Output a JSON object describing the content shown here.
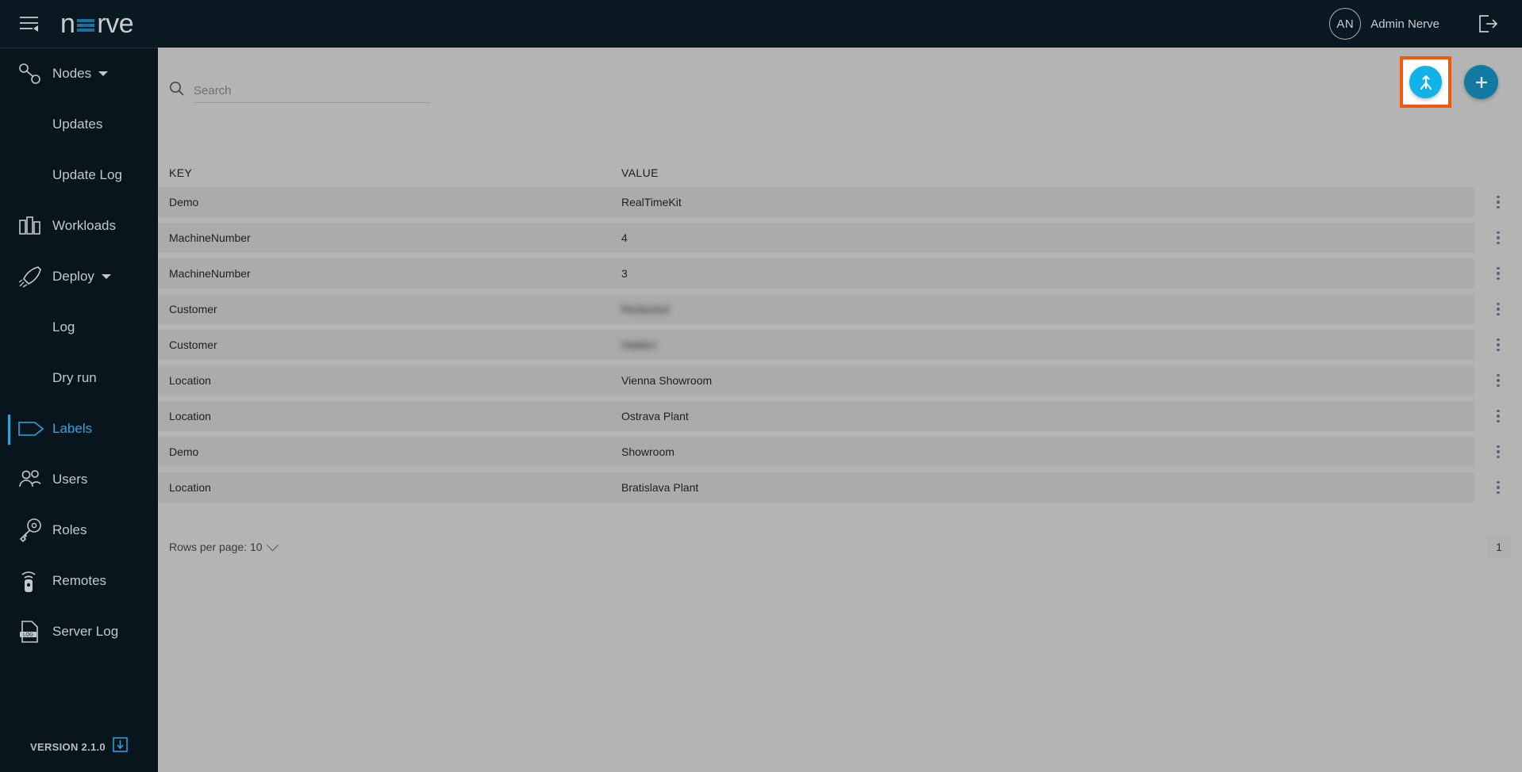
{
  "app": {
    "brand_prefix": "n",
    "brand_suffix": "rve",
    "menu_icon": "menu-collapse-icon"
  },
  "topbar": {
    "user_initials": "AN",
    "user_name": "Admin Nerve",
    "logout_icon": "logout-icon"
  },
  "sidebar": {
    "items": [
      {
        "label": "Nodes",
        "icon": "nodes-icon",
        "type": "group",
        "expanded": true,
        "active": false
      },
      {
        "label": "Updates",
        "icon": "",
        "type": "sub",
        "active": false
      },
      {
        "label": "Update Log",
        "icon": "",
        "type": "sub",
        "active": false
      },
      {
        "label": "Workloads",
        "icon": "workloads-icon",
        "type": "item",
        "active": false
      },
      {
        "label": "Deploy",
        "icon": "deploy-icon",
        "type": "group",
        "expanded": true,
        "active": false
      },
      {
        "label": "Log",
        "icon": "",
        "type": "sub",
        "active": false
      },
      {
        "label": "Dry run",
        "icon": "",
        "type": "sub",
        "active": false
      },
      {
        "label": "Labels",
        "icon": "label-tag-icon",
        "type": "item",
        "active": true
      },
      {
        "label": "Users",
        "icon": "users-icon",
        "type": "item",
        "active": false
      },
      {
        "label": "Roles",
        "icon": "roles-key-icon",
        "type": "item",
        "active": false
      },
      {
        "label": "Remotes",
        "icon": "remote-icon",
        "type": "item",
        "active": false
      },
      {
        "label": "Server Log",
        "icon": "server-log-icon",
        "type": "item",
        "active": false
      }
    ],
    "version_label": "VERSION 2.1.0",
    "version_icon": "download-icon"
  },
  "main": {
    "search": {
      "placeholder": "Search",
      "value": "",
      "icon": "search-icon"
    },
    "actions": [
      {
        "name": "merge-labels-button",
        "icon": "merge-icon",
        "color": "#10b2e8",
        "highlighted": true
      },
      {
        "name": "add-label-button",
        "icon": "plus-icon",
        "color": "#127aa2",
        "highlighted": false
      }
    ],
    "table": {
      "columns": [
        "KEY",
        "VALUE"
      ],
      "rows": [
        {
          "key": "Demo",
          "value": "RealTimeKit",
          "redacted": false
        },
        {
          "key": "MachineNumber",
          "value": "4",
          "redacted": false
        },
        {
          "key": "MachineNumber",
          "value": "3",
          "redacted": false
        },
        {
          "key": "Customer",
          "value": "Redacted",
          "redacted": true
        },
        {
          "key": "Customer",
          "value": "Hidden",
          "redacted": true
        },
        {
          "key": "Location",
          "value": "Vienna Showroom",
          "redacted": false
        },
        {
          "key": "Location",
          "value": "Ostrava Plant",
          "redacted": false
        },
        {
          "key": "Demo",
          "value": "Showroom",
          "redacted": false
        },
        {
          "key": "Location",
          "value": "Bratislava Plant",
          "redacted": false
        }
      ],
      "row_menu_icon": "kebab-menu-icon"
    },
    "footer": {
      "rows_per_page_label": "Rows per page: 10",
      "rows_per_page_value": "10",
      "current_page": "1"
    }
  },
  "colors": {
    "accent_cyan": "#2aa8e0",
    "brand_blue": "#1b6f9e",
    "highlight_orange": "#f4590b",
    "sidebar_bg": "#08151d",
    "topbar_bg": "#0a1821",
    "main_bg": "#b4b4b4",
    "row_bg": "#ababab"
  }
}
